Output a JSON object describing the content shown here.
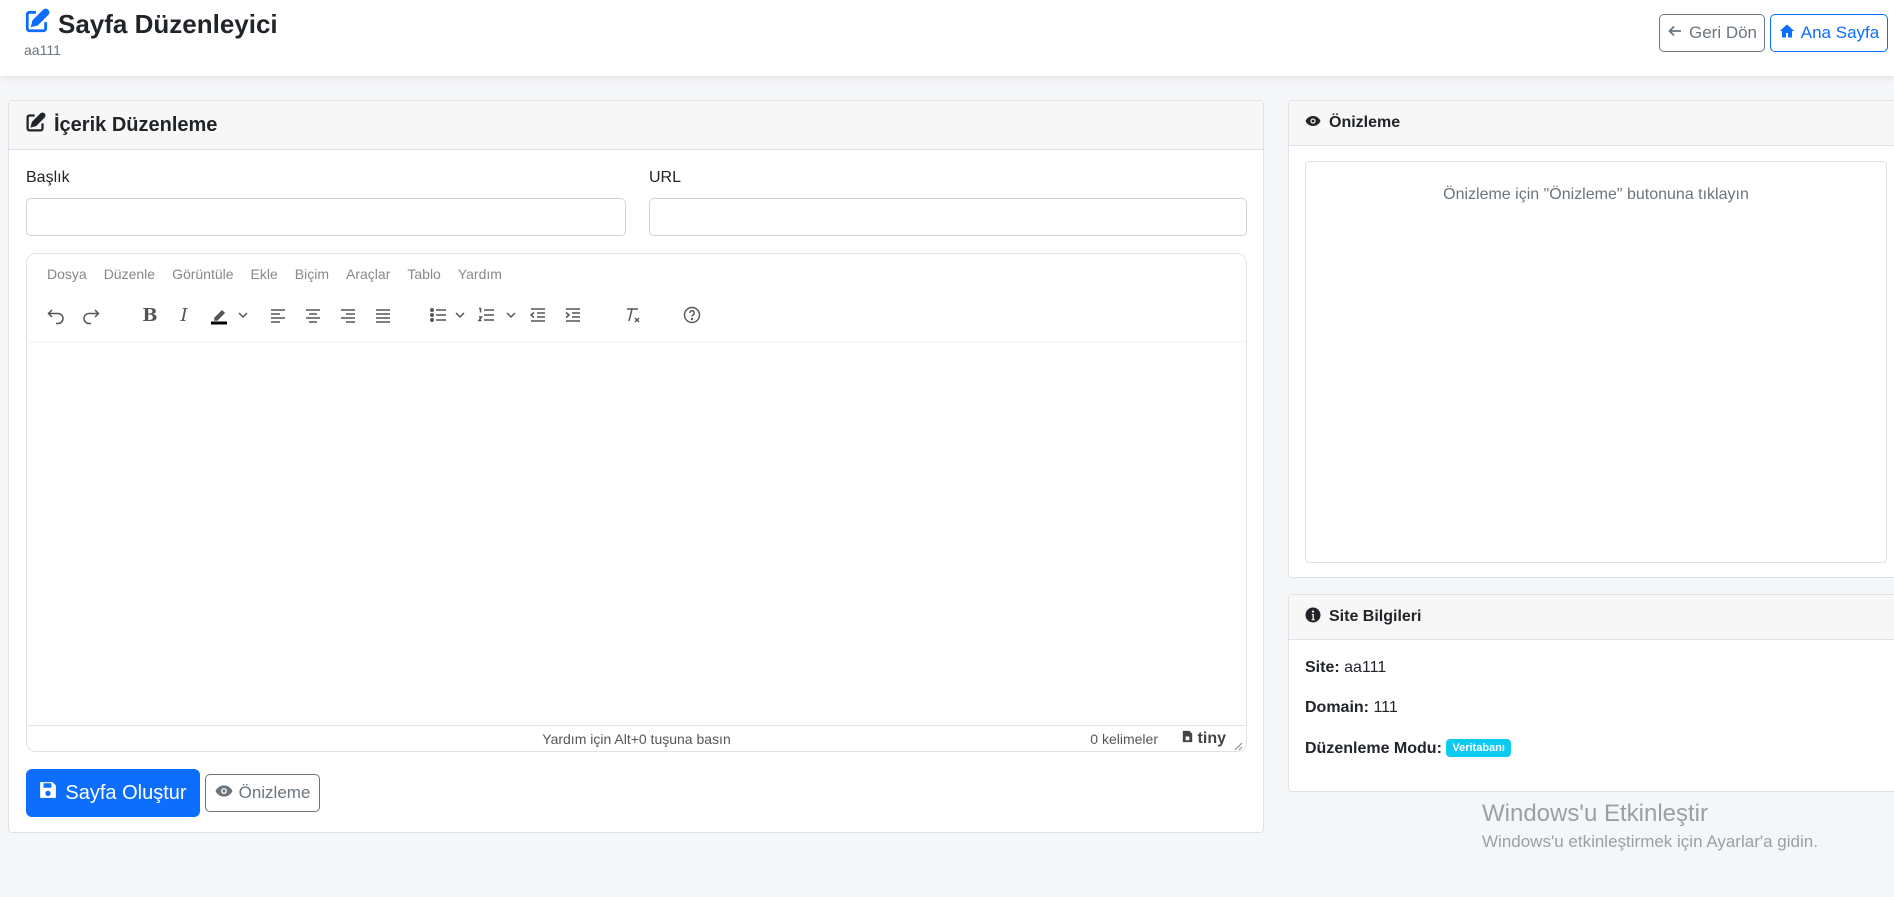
{
  "header": {
    "title": "Sayfa Düzenleyici",
    "subtitle": "aa111",
    "back_label": "Geri Dön",
    "home_label": "Ana Sayfa"
  },
  "editor_card": {
    "title": "İçerik Düzenleme",
    "title_label": "Başlık",
    "title_value": "",
    "url_label": "URL",
    "url_value": "",
    "menubar": [
      "Dosya",
      "Düzenle",
      "Görüntüle",
      "Ekle",
      "Biçim",
      "Araçlar",
      "Tablo",
      "Yardım"
    ],
    "bold_glyph": "B",
    "italic_glyph": "I",
    "status_help": "Yardım için Alt+0 tuşuna basın",
    "word_count": "0 kelimeler",
    "brand": "tiny",
    "create_label": "Sayfa Oluştur",
    "preview_label": "Önizleme",
    "toolbar_icons": [
      "undo-icon",
      "redo-icon",
      "bold-icon",
      "italic-icon",
      "highlight-icon",
      "align-left-icon",
      "align-center-icon",
      "align-right-icon",
      "justify-icon",
      "bullet-list-icon",
      "numbered-list-icon",
      "outdent-icon",
      "indent-icon",
      "clear-format-icon",
      "help-icon"
    ]
  },
  "preview_card": {
    "title": "Önizleme",
    "message": "Önizleme için \"Önizleme\" butonuna tıklayın"
  },
  "site_card": {
    "title": "Site Bilgileri",
    "site_label": "Site:",
    "site_value": "aa111",
    "domain_label": "Domain:",
    "domain_value": "111",
    "mode_label": "Düzenleme Modu:",
    "mode_value": "Veritabanı"
  },
  "watermark": {
    "title": "Windows'u Etkinleştir",
    "subtitle": "Windows'u etkinleştirmek için Ayarlar'a gidin."
  },
  "colors": {
    "primary": "#0d6efd",
    "secondary": "#6c757d",
    "badge": "#0dcaf0"
  }
}
